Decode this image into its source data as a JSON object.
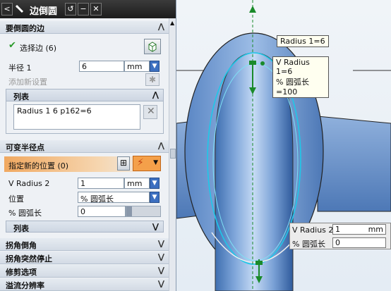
{
  "titlebar": {
    "title": "边倒圆",
    "back_label": "<",
    "restore_label": "↺",
    "minimize_label": "−",
    "close_label": "✕"
  },
  "edges_section": {
    "title": "要倒圆的边",
    "select_edge_label": "选择边 (6)",
    "radius_label": "半径 1",
    "radius_value": "6",
    "radius_unit": "mm",
    "add_new_set_label": "添加新设置",
    "list_title": "列表",
    "list_items": [
      "Radius 1   6   p162=6"
    ]
  },
  "variable_section": {
    "title": "可变半径点",
    "specify_location_label": "指定新的位置 (0)",
    "v_radius_label": "V Radius 2",
    "v_radius_value": "1",
    "v_radius_unit": "mm",
    "position_label": "位置",
    "position_value": "% 圆弧长",
    "arc_length_label": "% 圆弧长",
    "arc_length_value": "0",
    "list_title": "列表"
  },
  "collapsed_sections": [
    "拐角倒角",
    "拐角突然停止",
    "修剪选项",
    "溢流分辨率"
  ],
  "viewport": {
    "tooltip_radius1": "Radius 1=6",
    "tooltip_v_radius1_line1": "V Radius 1=6",
    "tooltip_v_radius1_line2": "% 圆弧长=100",
    "bottom_v_radius_label": "V Radius 2",
    "bottom_v_radius_value": "1",
    "bottom_v_radius_unit": "mm",
    "bottom_arc_label": "% 圆弧长",
    "bottom_arc_value": "0"
  },
  "colors": {
    "accent_orange": "#f0a860",
    "check_green": "#2a9a2a",
    "dropdown_blue": "#3c6fc0",
    "highlight_cyan": "#1ec8e8"
  }
}
